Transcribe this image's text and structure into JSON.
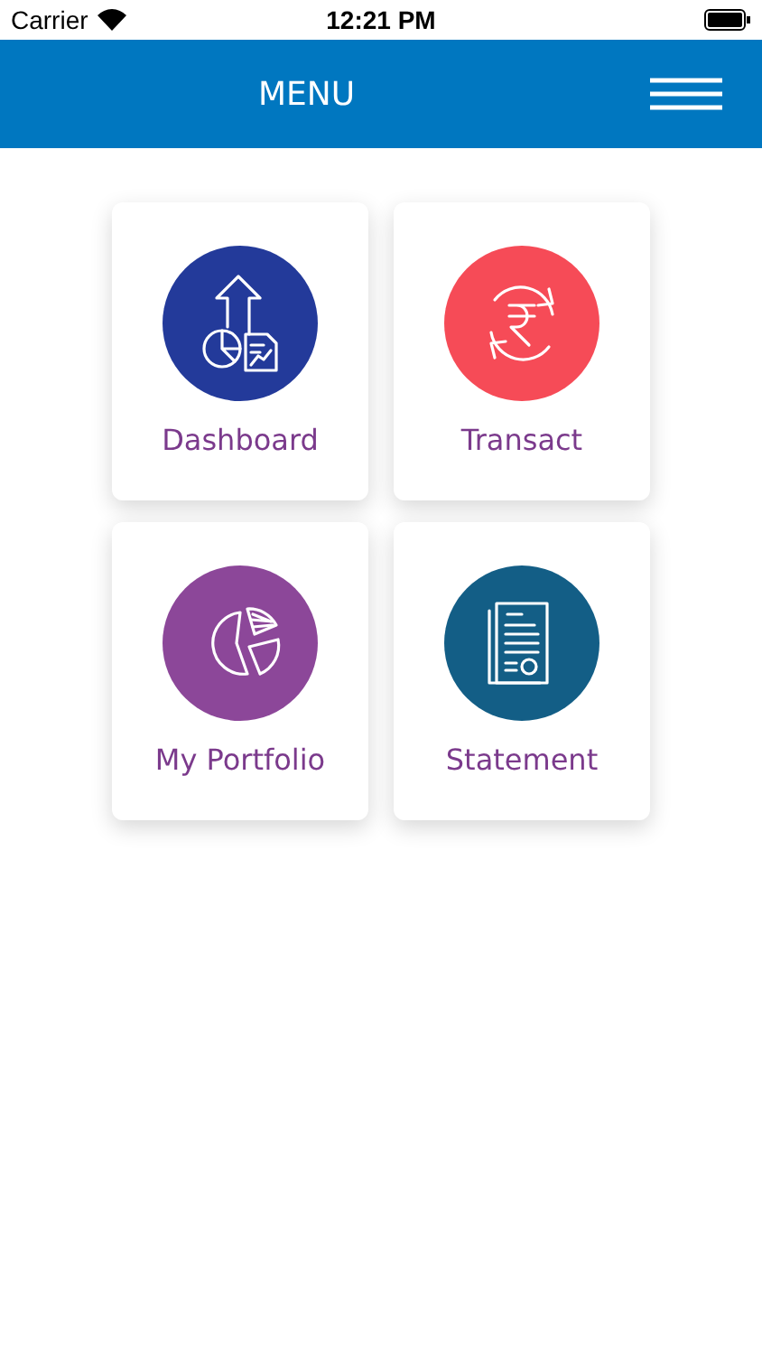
{
  "status_bar": {
    "carrier": "Carrier",
    "time": "12:21 PM"
  },
  "header": {
    "title": "MENU"
  },
  "menu_items": [
    {
      "label": "Dashboard",
      "kind": "dashboard",
      "color": "#233a9a"
    },
    {
      "label": "Transact",
      "kind": "transact",
      "color": "#f64b57"
    },
    {
      "label": "My Portfolio",
      "kind": "portfolio",
      "color": "#8c4799"
    },
    {
      "label": "Statement",
      "kind": "statement",
      "color": "#135e86"
    }
  ]
}
